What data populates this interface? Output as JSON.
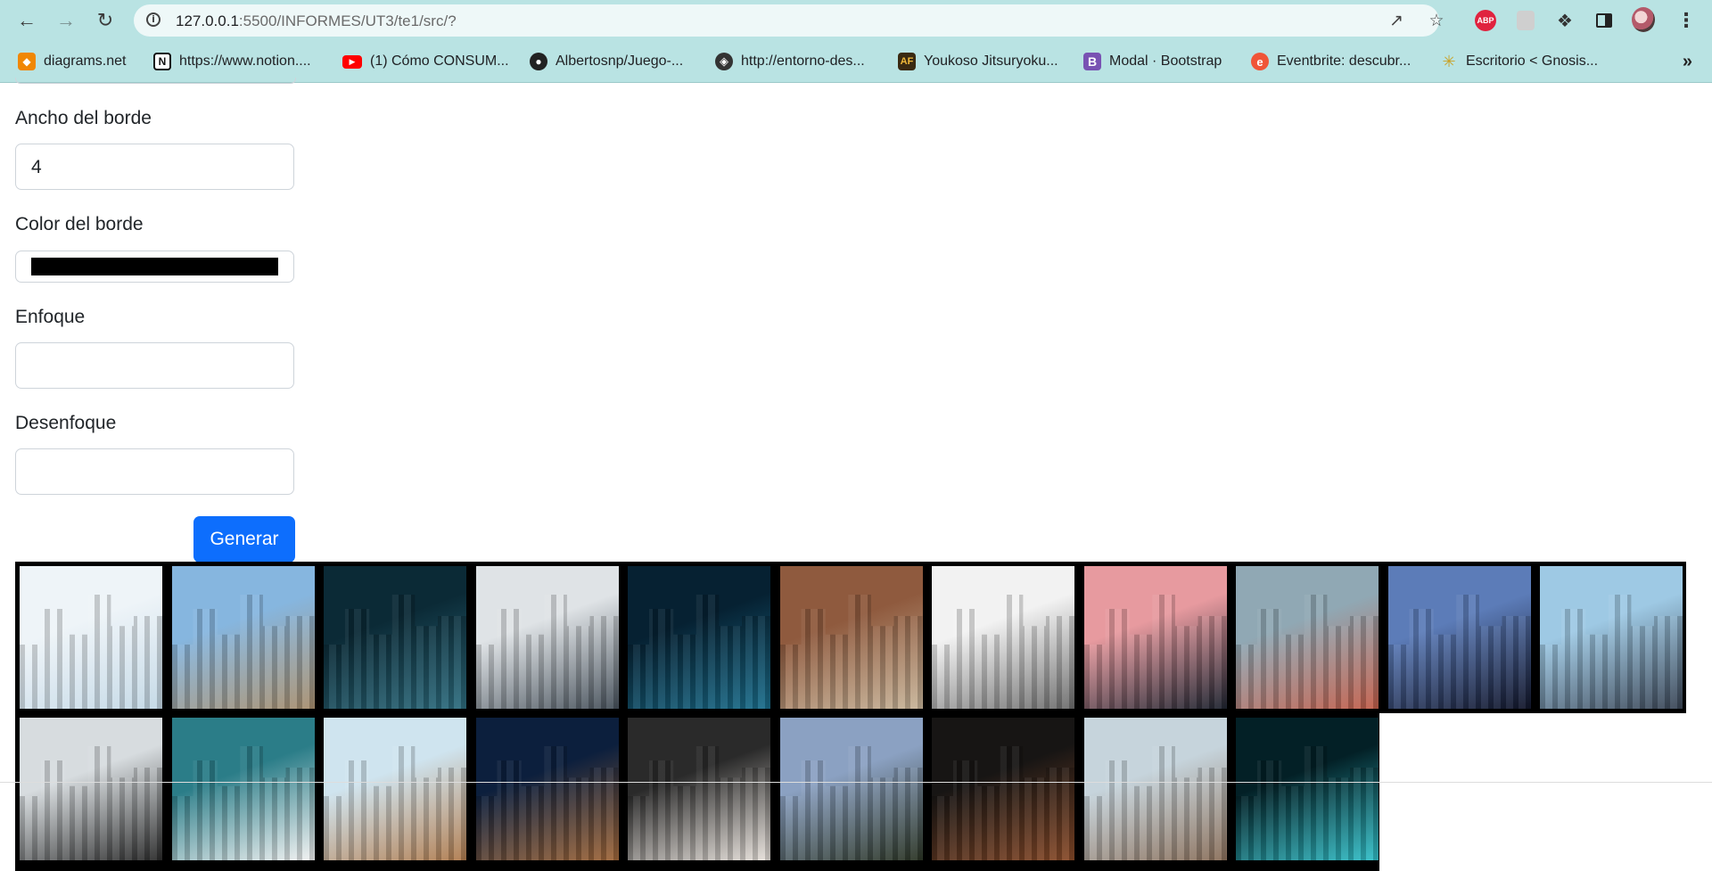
{
  "browser": {
    "url_host": "127.0.0.1",
    "url_rest": ":5500/INFORMES/UT3/te1/src/?",
    "bookmarks": [
      {
        "label": "diagrams.net",
        "icon": "diagrams-icon",
        "color": "#f08705"
      },
      {
        "label": "https://www.notion....",
        "icon": "notion-icon",
        "color": "#111111"
      },
      {
        "label": "(1) Cómo CONSUM...",
        "icon": "youtube-icon",
        "color": "#ff0000"
      },
      {
        "label": "Albertosnp/Juego-...",
        "icon": "github-icon",
        "color": "#222222"
      },
      {
        "label": "http://entorno-des...",
        "icon": "globe-icon",
        "color": "#333333"
      },
      {
        "label": "Youkoso Jitsuryoku...",
        "icon": "af-icon",
        "color": "#3a2a12"
      },
      {
        "label": "Modal · Bootstrap",
        "icon": "bootstrap-icon",
        "color": "#7952b3"
      },
      {
        "label": "Eventbrite: descubr...",
        "icon": "eventbrite-icon",
        "color": "#f05537"
      },
      {
        "label": "Escritorio < Gnosis...",
        "icon": "gnosis-icon",
        "color": "#c9a227"
      }
    ]
  },
  "form": {
    "border_width_label": "Ancho del borde",
    "border_width_value": "4",
    "border_color_label": "Color del borde",
    "border_color_value": "#000000",
    "focus_label": "Enfoque",
    "focus_value": "",
    "blur_label": "Desenfoque",
    "blur_value": "",
    "generate_button": "Generar"
  },
  "gallery": {
    "border_color": "#000000",
    "row1": [
      {
        "name": "glass-facade",
        "colors": [
          "#eef4f8",
          "#c3d8e6"
        ]
      },
      {
        "name": "curved-building",
        "colors": [
          "#86b6df",
          "#a88f6e"
        ]
      },
      {
        "name": "bridge-night",
        "colors": [
          "#0b2a36",
          "#2f6e80"
        ]
      },
      {
        "name": "angular-tower",
        "colors": [
          "#dfe3e6",
          "#46505a"
        ]
      },
      {
        "name": "office-night",
        "colors": [
          "#062132",
          "#1c6f8d"
        ]
      },
      {
        "name": "old-street",
        "colors": [
          "#8f5a3e",
          "#c8b59a"
        ]
      },
      {
        "name": "white-balconies",
        "colors": [
          "#f2f2f2",
          "#6d6d6d"
        ]
      },
      {
        "name": "sunset-skyline",
        "colors": [
          "#e79a9f",
          "#1e2430"
        ]
      },
      {
        "name": "aerial-city",
        "colors": [
          "#90a8b4",
          "#c25e4a"
        ]
      },
      {
        "name": "skyline-reflection",
        "colors": [
          "#5c7cb8",
          "#12162a"
        ]
      },
      {
        "name": "tower-sky",
        "colors": [
          "#9ec9e4",
          "#3b4656"
        ]
      }
    ],
    "row2": [
      {
        "name": "skyscrapers-up",
        "colors": [
          "#d7dcdf",
          "#2b2b2b"
        ]
      },
      {
        "name": "sydney-opera",
        "colors": [
          "#2b7d88",
          "#f2f2f2"
        ]
      },
      {
        "name": "venice-tower",
        "colors": [
          "#cfe4ef",
          "#b07b4d"
        ]
      },
      {
        "name": "radio-tower-night",
        "colors": [
          "#0c1f3d",
          "#a1683a"
        ]
      },
      {
        "name": "aerial-symmetry",
        "colors": [
          "#2a2a2a",
          "#e8e2dc"
        ]
      },
      {
        "name": "mountain-church",
        "colors": [
          "#8ba1c2",
          "#2b3424"
        ]
      },
      {
        "name": "street-night",
        "colors": [
          "#171514",
          "#8a4c2a"
        ]
      },
      {
        "name": "tram-street",
        "colors": [
          "#c6d4dc",
          "#8a6f5a"
        ]
      },
      {
        "name": "light-trails",
        "colors": [
          "#032026",
          "#33c0c9"
        ]
      }
    ]
  }
}
